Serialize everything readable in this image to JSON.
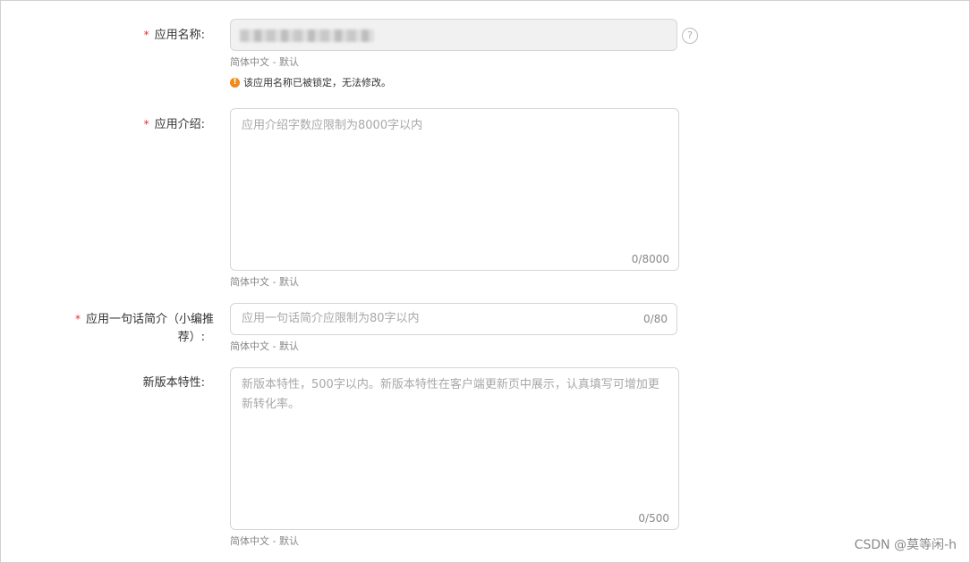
{
  "form": {
    "app_name": {
      "required_mark": "*",
      "label": "应用名称:",
      "lang_hint": "简体中文 - 默认",
      "warning": "该应用名称已被锁定，无法修改。",
      "warning_icon": "!",
      "help_icon": "?"
    },
    "app_intro": {
      "required_mark": "*",
      "label": "应用介绍:",
      "placeholder": "应用介绍字数应限制为8000字以内",
      "counter": "0/8000",
      "lang_hint": "简体中文 - 默认"
    },
    "app_summary": {
      "required_mark": "*",
      "label_line1": "应用一句话简介（小编推",
      "label_line2": "荐）:",
      "placeholder": "应用一句话简介应限制为80字以内",
      "counter": "0/80",
      "lang_hint": "简体中文 - 默认"
    },
    "new_features": {
      "label": "新版本特性:",
      "placeholder": "新版本特性，500字以内。新版本特性在客户端更新页中展示，认真填写可增加更新转化率。",
      "counter": "0/500",
      "lang_hint": "简体中文 - 默认"
    }
  },
  "watermark": "CSDN @莫等闲-h"
}
